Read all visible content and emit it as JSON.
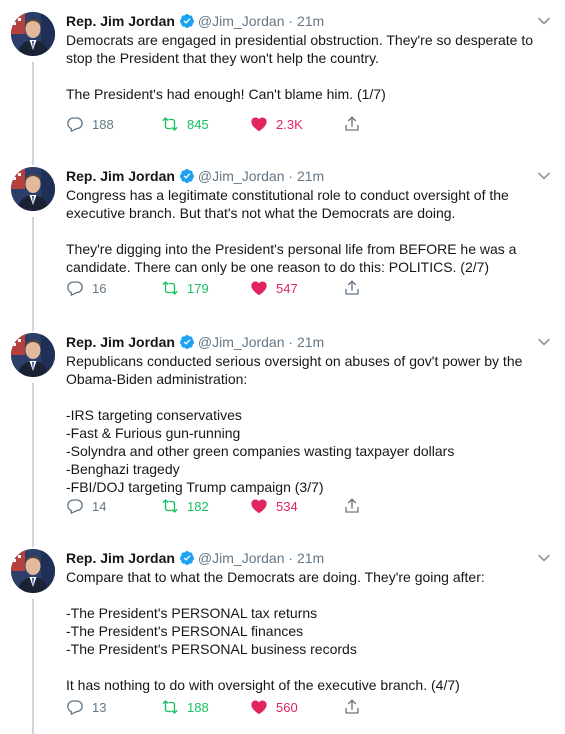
{
  "author": {
    "name": "Rep. Jim Jordan",
    "handle": "@Jim_Jordan",
    "separator": "·"
  },
  "tweets": [
    {
      "time": "21m",
      "text": "Democrats are engaged in presidential obstruction. They're so desperate to stop the President that they won't help the country.\n\nThe President's had enough! Can't blame him. (1/7)",
      "replies": "188",
      "retweets": "845",
      "likes": "2.3K"
    },
    {
      "time": "21m",
      "text": "Congress has a legitimate constitutional role to conduct oversight of the executive branch. But that's not what the Democrats are doing.\n\nThey're digging into the President's personal life from BEFORE he was a candidate. There can only be one reason to do this: POLITICS. (2/7)",
      "replies": "16",
      "retweets": "179",
      "likes": "547"
    },
    {
      "time": "21m",
      "text": "Republicans conducted serious oversight on abuses of gov't power by the Obama-Biden administration:\n\n-IRS targeting conservatives\n-Fast & Furious gun-running\n-Solyndra and other green companies wasting taxpayer dollars\n-Benghazi tragedy\n-FBI/DOJ targeting Trump campaign (3/7)",
      "replies": "14",
      "retweets": "182",
      "likes": "534"
    },
    {
      "time": "21m",
      "text": "Compare that to what the Democrats are doing. They're going after:\n\n-The President's PERSONAL tax returns\n-The President's PERSONAL finances\n-The President's PERSONAL business records\n\nIt has nothing to do with oversight of the executive branch. (4/7)",
      "replies": "13",
      "retweets": "188",
      "likes": "560"
    }
  ],
  "colors": {
    "verified": "#1da1f2",
    "retweet": "#17bf63",
    "like": "#e0245e",
    "muted": "#657786",
    "thread_line": "#ccd6dd"
  },
  "icons": [
    "avatar",
    "verified-badge-icon",
    "chevron-down-icon",
    "reply-icon",
    "retweet-icon",
    "heart-icon",
    "share-icon"
  ]
}
